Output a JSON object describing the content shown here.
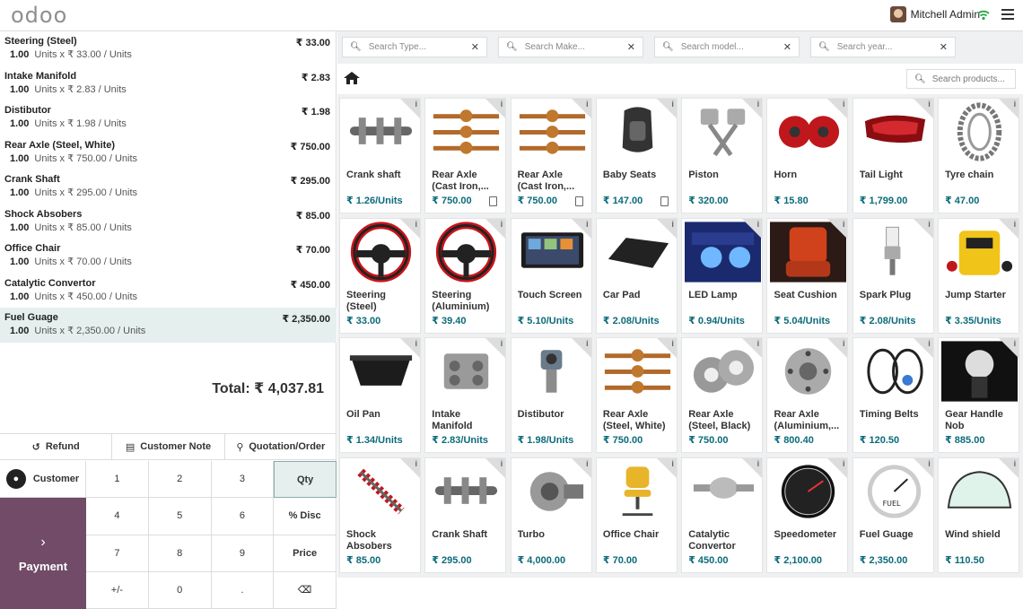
{
  "topbar": {
    "logo": "odoo",
    "user_name": "Mitchell Admin"
  },
  "orderlines": [
    {
      "name": "Steering (Steel)",
      "price": "₹ 33.00",
      "qty": "1.00",
      "detail": "Units x ₹ 33.00 / Units"
    },
    {
      "name": "Intake Manifold",
      "price": "₹ 2.83",
      "qty": "1.00",
      "detail": "Units x ₹ 2.83 / Units"
    },
    {
      "name": "Distibutor",
      "price": "₹ 1.98",
      "qty": "1.00",
      "detail": "Units x ₹ 1.98 / Units"
    },
    {
      "name": "Rear Axle (Steel, White)",
      "price": "₹ 750.00",
      "qty": "1.00",
      "detail": "Units x ₹ 750.00 / Units"
    },
    {
      "name": "Crank Shaft",
      "price": "₹ 295.00",
      "qty": "1.00",
      "detail": "Units x ₹ 295.00 / Units"
    },
    {
      "name": "Shock Absobers",
      "price": "₹ 85.00",
      "qty": "1.00",
      "detail": "Units x ₹ 85.00 / Units"
    },
    {
      "name": "Office Chair",
      "price": "₹ 70.00",
      "qty": "1.00",
      "detail": "Units x ₹ 70.00 / Units"
    },
    {
      "name": "Catalytic Convertor",
      "price": "₹ 450.00",
      "qty": "1.00",
      "detail": "Units x ₹ 450.00 / Units"
    },
    {
      "name": "Fuel Guage",
      "price": "₹ 2,350.00",
      "qty": "1.00",
      "detail": "Units x ₹ 2,350.00 / Units"
    }
  ],
  "total": "Total: ₹ 4,037.81",
  "controls": {
    "refund": "Refund",
    "customer_note": "Customer Note",
    "quotation": "Quotation/Order",
    "customer": "Customer",
    "payment": "Payment"
  },
  "numpad": [
    "1",
    "2",
    "3",
    "Qty",
    "4",
    "5",
    "6",
    "% Disc",
    "7",
    "8",
    "9",
    "Price",
    "+/-",
    "0",
    ".",
    "⌫"
  ],
  "filters": [
    {
      "placeholder": "Search Type..."
    },
    {
      "placeholder": "Search Make..."
    },
    {
      "placeholder": "Search model..."
    },
    {
      "placeholder": "Search year..."
    }
  ],
  "product_search_placeholder": "Search products...",
  "products": [
    {
      "name": "Crank shaft",
      "price": "₹ 1.26/Units",
      "icon": "crank-shaft"
    },
    {
      "name": "Rear Axle (Cast Iron,...",
      "price": "₹ 750.00",
      "icon": "rear-axle"
    },
    {
      "name": "Rear Axle (Cast Iron,...",
      "price": "₹ 750.00",
      "icon": "rear-axle"
    },
    {
      "name": "Baby Seats",
      "price": "₹ 147.00",
      "icon": "baby-seat"
    },
    {
      "name": "Piston",
      "price": "₹ 320.00",
      "icon": "piston"
    },
    {
      "name": "Horn",
      "price": "₹ 15.80",
      "icon": "horn"
    },
    {
      "name": "Tail Light",
      "price": "₹ 1,799.00",
      "icon": "tail-light"
    },
    {
      "name": "Tyre chain",
      "price": "₹ 47.00",
      "icon": "tyre-chain"
    },
    {
      "name": "Steering (Steel)",
      "price": "₹ 33.00",
      "icon": "steering"
    },
    {
      "name": "Steering (Aluminium)",
      "price": "₹ 39.40",
      "icon": "steering"
    },
    {
      "name": "Touch Screen",
      "price": "₹ 5.10/Units",
      "icon": "touch-screen"
    },
    {
      "name": "Car Pad",
      "price": "₹ 2.08/Units",
      "icon": "car-pad"
    },
    {
      "name": "LED Lamp",
      "price": "₹ 0.94/Units",
      "icon": "led-lamp"
    },
    {
      "name": "Seat Cushion",
      "price": "₹ 5.04/Units",
      "icon": "seat-cushion"
    },
    {
      "name": "Spark Plug",
      "price": "₹ 2.08/Units",
      "icon": "spark-plug"
    },
    {
      "name": "Jump Starter",
      "price": "₹ 3.35/Units",
      "icon": "jump-starter"
    },
    {
      "name": "Oil Pan",
      "price": "₹ 1.34/Units",
      "icon": "oil-pan"
    },
    {
      "name": "Intake Manifold",
      "price": "₹ 2.83/Units",
      "icon": "intake-manifold"
    },
    {
      "name": "Distibutor",
      "price": "₹ 1.98/Units",
      "icon": "distributor"
    },
    {
      "name": "Rear Axle (Steel, White)",
      "price": "₹ 750.00",
      "icon": "rear-axle"
    },
    {
      "name": "Rear Axle (Steel, Black)",
      "price": "₹ 750.00",
      "icon": "bearing"
    },
    {
      "name": "Rear Axle (Aluminium,...",
      "price": "₹ 800.40",
      "icon": "wheel-hub"
    },
    {
      "name": "Timing Belts",
      "price": "₹ 120.50",
      "icon": "timing-belt"
    },
    {
      "name": "Gear Handle Nob",
      "price": "₹ 885.00",
      "icon": "gear-knob"
    },
    {
      "name": "Shock Absobers",
      "price": "₹ 85.00",
      "icon": "shock-absorber"
    },
    {
      "name": "Crank Shaft",
      "price": "₹ 295.00",
      "icon": "crank-shaft"
    },
    {
      "name": "Turbo",
      "price": "₹ 4,000.00",
      "icon": "turbo"
    },
    {
      "name": "Office Chair",
      "price": "₹ 70.00",
      "icon": "office-chair"
    },
    {
      "name": "Catalytic Convertor",
      "price": "₹ 450.00",
      "icon": "catalytic-converter"
    },
    {
      "name": "Speedometer",
      "price": "₹ 2,100.00",
      "icon": "speedometer"
    },
    {
      "name": "Fuel Guage",
      "price": "₹ 2,350.00",
      "icon": "fuel-gauge"
    },
    {
      "name": "Wind shield",
      "price": "₹ 110.50",
      "icon": "windshield"
    }
  ],
  "product_flags": {
    "tablet_icon_indexes": [
      1,
      2,
      3
    ]
  },
  "colors": {
    "accent": "#714b67",
    "selected_row": "#e5f0ee",
    "price": "#0b6b7a"
  }
}
